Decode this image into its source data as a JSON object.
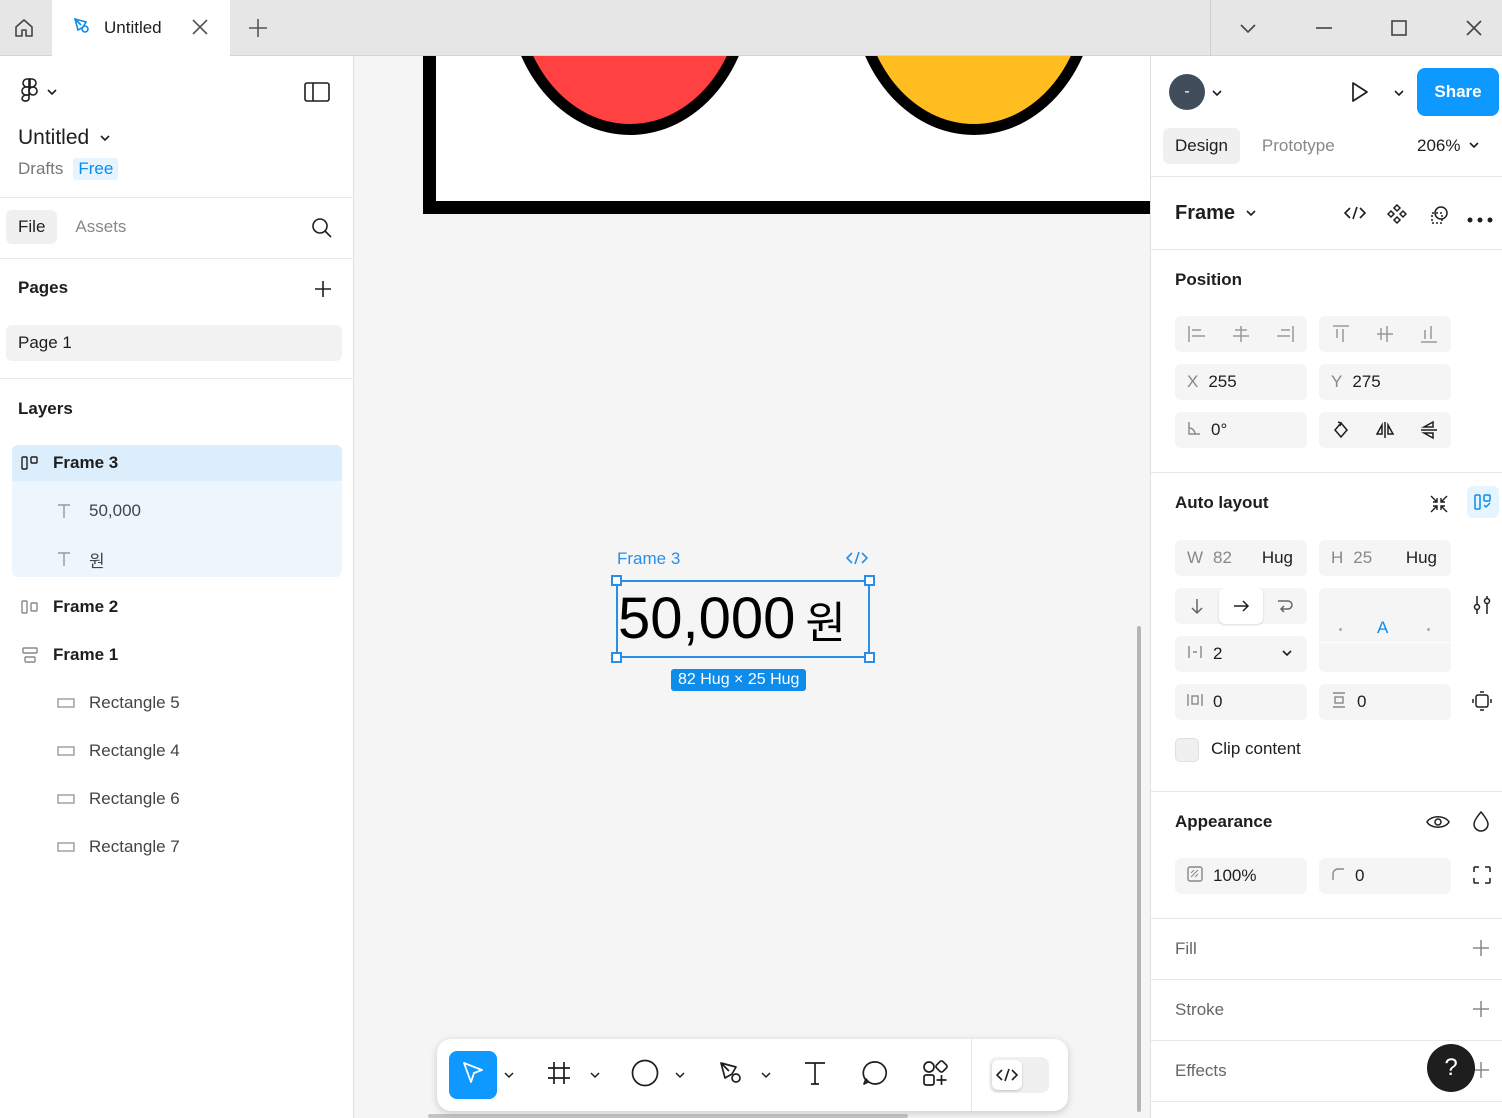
{
  "titlebar": {
    "tab_label": "Untitled"
  },
  "left": {
    "file_name": "Untitled",
    "drafts_label": "Drafts",
    "plan_badge": "Free",
    "tabs": [
      "File",
      "Assets"
    ],
    "pages_title": "Pages",
    "pages": [
      "Page 1"
    ],
    "layers_title": "Layers",
    "layers": [
      {
        "name": "Frame 3",
        "type": "frame-horizontal"
      },
      {
        "name": "50,000",
        "type": "text"
      },
      {
        "name": "원",
        "type": "text"
      },
      {
        "name": "Frame 2",
        "type": "frame-horizontal"
      },
      {
        "name": "Frame 1",
        "type": "frame-vertical"
      },
      {
        "name": "Rectangle 5",
        "type": "rectangle"
      },
      {
        "name": "Rectangle 4",
        "type": "rectangle"
      },
      {
        "name": "Rectangle 6",
        "type": "rectangle"
      },
      {
        "name": "Rectangle 7",
        "type": "rectangle"
      }
    ]
  },
  "canvas": {
    "selection_label": "Frame 3",
    "selection_text": "50,000",
    "selection_unit": "원",
    "selection_dims": "82 Hug × 25 Hug",
    "colors": {
      "red": "#ff4141",
      "yellow": "#ffbd1f",
      "selection": "#2a8ee8"
    }
  },
  "right": {
    "avatar_initial": "-",
    "share_label": "Share",
    "tabs": [
      "Design",
      "Prototype"
    ],
    "zoom": "206%",
    "frame_title": "Frame",
    "position_title": "Position",
    "x_label": "X",
    "x_value": "255",
    "y_label": "Y",
    "y_value": "275",
    "rotation_value": "0°",
    "autolayout_title": "Auto layout",
    "w_label": "W",
    "w_value": "82",
    "w_mode": "Hug",
    "h_label": "H",
    "h_value": "25",
    "h_mode": "Hug",
    "gap_value": "2",
    "padding_h_value": "0",
    "padding_v_value": "0",
    "align_letter": "A",
    "clip_label": "Clip content",
    "appearance_title": "Appearance",
    "opacity_value": "100%",
    "radius_value": "0",
    "fill_title": "Fill",
    "stroke_title": "Stroke",
    "effects_title": "Effects",
    "help_label": "?"
  },
  "colors": {
    "accent": "#0d99ff",
    "badge_bg": "#e5f4ff"
  }
}
